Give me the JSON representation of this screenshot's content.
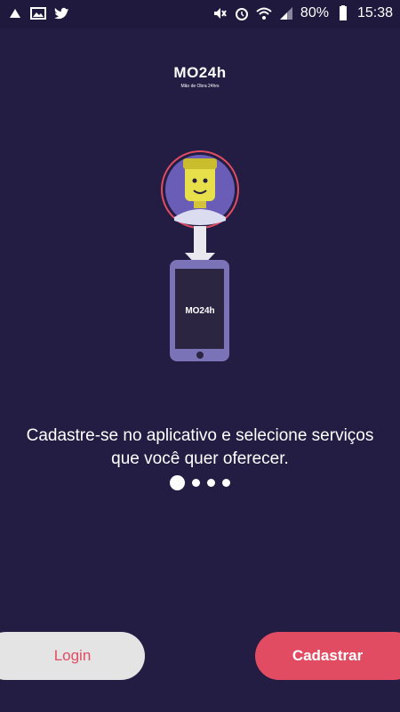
{
  "status_bar": {
    "battery_percent": "80%",
    "time": "15:38",
    "left_icons": [
      "notification-icon",
      "image-icon",
      "twitter-icon"
    ],
    "right_icons": [
      "mute-icon",
      "alarm-icon",
      "wifi-icon",
      "signal-icon",
      "battery-icon"
    ]
  },
  "logo": {
    "text": "MO24h",
    "subtitle": "Mão de Obra 24hrs"
  },
  "illustration": {
    "phone_logo": "MO24h"
  },
  "onboarding": {
    "caption_line1": "Cadastre-se no aplicativo e selecione serviços",
    "caption_line2": "que você quer oferecer.",
    "page_count": 4,
    "active_page": 1
  },
  "buttons": {
    "login_label": "Login",
    "cadastrar_label": "Cadastrar"
  },
  "colors": {
    "background": "#231d43",
    "accent": "#e14c63",
    "login_bg": "#e4e4e4"
  }
}
